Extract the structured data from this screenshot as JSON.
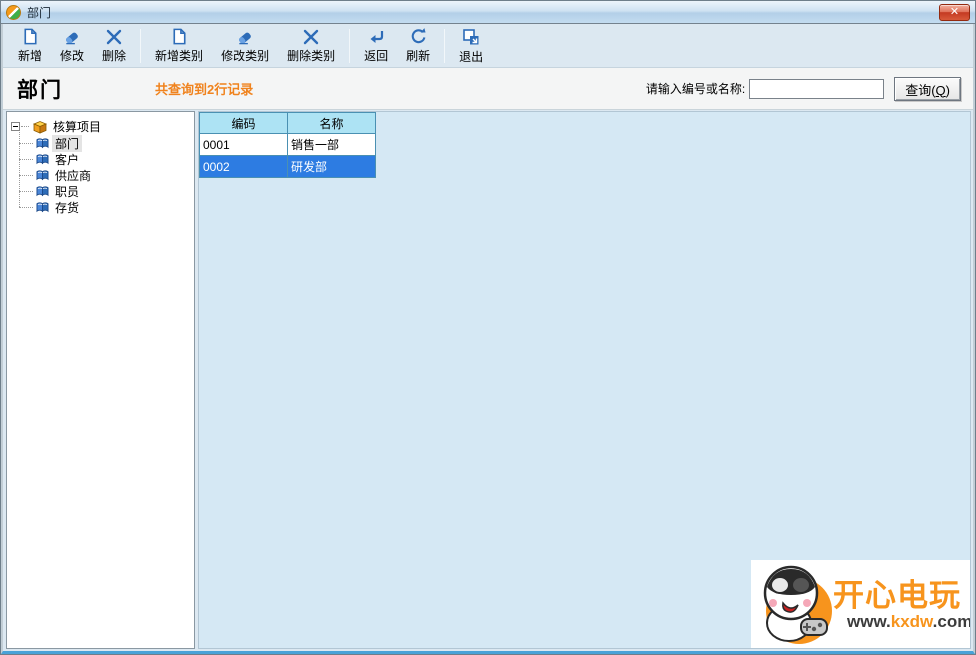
{
  "window": {
    "title": "部门",
    "close_glyph": "✕"
  },
  "toolbar": {
    "buttons": [
      {
        "label": "新增",
        "icon": "new-document"
      },
      {
        "label": "修改",
        "icon": "eraser-edit"
      },
      {
        "label": "删除",
        "icon": "x-delete"
      },
      {
        "label": "新增类别",
        "icon": "new-document"
      },
      {
        "label": "修改类别",
        "icon": "eraser-edit"
      },
      {
        "label": "删除类别",
        "icon": "x-delete"
      },
      {
        "label": "返回",
        "icon": "return-arrow"
      },
      {
        "label": "刷新",
        "icon": "refresh-arrow"
      },
      {
        "label": "退出",
        "icon": "exit-window"
      }
    ]
  },
  "header": {
    "title": "部门",
    "record_count": "共查询到2行记录",
    "search_label": "请输入编号或名称:",
    "search_value": "",
    "query_button": {
      "prefix": "查询(",
      "key": "Q",
      "suffix": ")"
    }
  },
  "tree": {
    "root_label": "核算项目",
    "items": [
      {
        "label": "部门",
        "selected": true
      },
      {
        "label": "客户",
        "selected": false
      },
      {
        "label": "供应商",
        "selected": false
      },
      {
        "label": "职员",
        "selected": false
      },
      {
        "label": "存货",
        "selected": false
      }
    ]
  },
  "table": {
    "columns": [
      "编码",
      "名称"
    ],
    "rows": [
      {
        "code": "0001",
        "name": "销售一部",
        "selected": false
      },
      {
        "code": "0002",
        "name": "研发部",
        "selected": true
      }
    ]
  },
  "watermark": {
    "title": "开心电玩",
    "url_prefix": "www.",
    "url_name": "kxdw",
    "url_suffix": ".com"
  },
  "colors": {
    "selected_row_bg": "#2d7ce2",
    "record_count_text": "#f0831e",
    "table_header_bg": "#ade3f4",
    "toolbar_icon_blue": "#2d6cb8",
    "watermark_orange": "#f7941d",
    "titlebar_gradient_top": "#ecf4fb",
    "titlebar_gradient_bottom": "#b3cfe8",
    "main_panel_bg": "#d5e8f4"
  }
}
